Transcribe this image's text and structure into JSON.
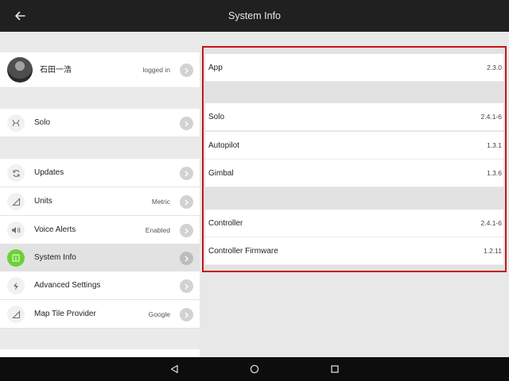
{
  "header": {
    "title": "System Info"
  },
  "sidebar": {
    "profile": {
      "name": "石田一浩",
      "status": "logged in"
    },
    "items": [
      {
        "label": "Solo",
        "value": "",
        "icon": "solo-drone-icon"
      },
      {
        "label": "Updates",
        "value": "",
        "icon": "refresh-icon"
      },
      {
        "label": "Units",
        "value": "Metric",
        "icon": "ruler-icon"
      },
      {
        "label": "Voice Alerts",
        "value": "Enabled",
        "icon": "speaker-icon"
      },
      {
        "label": "System Info",
        "value": "",
        "icon": "info-icon",
        "active": true
      },
      {
        "label": "Advanced Settings",
        "value": "",
        "icon": "lightning-icon"
      },
      {
        "label": "Map Tile Provider",
        "value": "Google",
        "icon": "map-icon"
      }
    ]
  },
  "system_info": {
    "app": {
      "label": "App",
      "value": "2.3.0"
    },
    "solo": {
      "label": "Solo",
      "value": "2.4.1-6"
    },
    "autopilot": {
      "label": "Autopilot",
      "value": "1.3.1"
    },
    "gimbal": {
      "label": "Gimbal",
      "value": "1.3.6"
    },
    "controller": {
      "label": "Controller",
      "value": "2.4.1-6"
    },
    "controller_firmware": {
      "label": "Controller Firmware",
      "value": "1.2.11"
    }
  },
  "colors": {
    "header_bg": "#202020",
    "highlight_border": "#c3161c",
    "active_icon": "#6bd233",
    "navbar_bg": "#0d0d0d"
  }
}
